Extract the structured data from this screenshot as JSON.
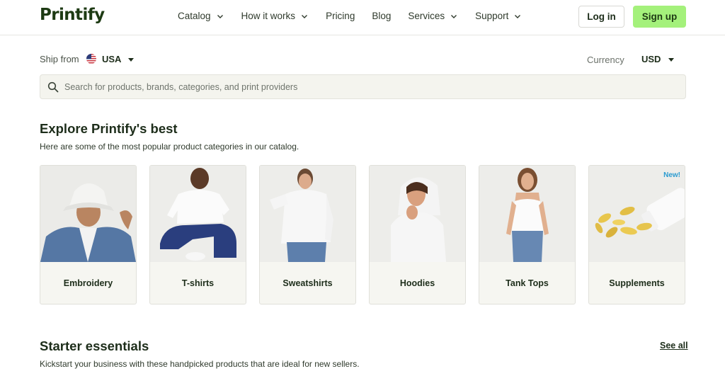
{
  "header": {
    "logo": "Printify",
    "nav": [
      {
        "label": "Catalog",
        "dropdown": true
      },
      {
        "label": "How it works",
        "dropdown": true
      },
      {
        "label": "Pricing",
        "dropdown": false
      },
      {
        "label": "Blog",
        "dropdown": false
      },
      {
        "label": "Services",
        "dropdown": true
      },
      {
        "label": "Support",
        "dropdown": true
      }
    ],
    "login": "Log in",
    "signup": "Sign up"
  },
  "ship": {
    "label": "Ship from",
    "value": "USA",
    "flag_icon": "us-flag-icon"
  },
  "currency": {
    "label": "Currency",
    "value": "USD"
  },
  "search": {
    "placeholder": "Search for products, brands, categories, and print providers"
  },
  "explore": {
    "title": "Explore Printify's best",
    "subtitle": "Here are some of the most popular product categories in our catalog.",
    "cards": [
      {
        "label": "Embroidery",
        "badge": ""
      },
      {
        "label": "T-shirts",
        "badge": ""
      },
      {
        "label": "Sweatshirts",
        "badge": ""
      },
      {
        "label": "Hoodies",
        "badge": ""
      },
      {
        "label": "Tank Tops",
        "badge": ""
      },
      {
        "label": "Supplements",
        "badge": "New!"
      }
    ]
  },
  "starter": {
    "title": "Starter essentials",
    "subtitle": "Kickstart your business with these handpicked products that are ideal for new sellers.",
    "see_all": "See all"
  },
  "colors": {
    "accent": "#a4f17b",
    "brand_dark": "#1d3a13",
    "badge_new": "#2a9bd0",
    "search_bg": "#f4f4ee"
  }
}
